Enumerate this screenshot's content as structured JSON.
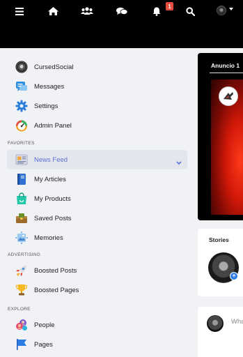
{
  "topbar": {
    "icons": [
      "menu-icon",
      "home-icon",
      "friends-icon",
      "chat-icon",
      "bell-icon",
      "search-icon"
    ],
    "notification_count": "1"
  },
  "sidebar": {
    "main_items": [
      {
        "label": "CursedSocial",
        "icon": "profile-avatar"
      },
      {
        "label": "Messages",
        "icon": "messages-icon"
      },
      {
        "label": "Settings",
        "icon": "gear-icon"
      },
      {
        "label": "Admin Panel",
        "icon": "gauge-icon"
      }
    ],
    "favorites_title": "FAVORITES",
    "favorites": [
      {
        "label": "News Feed",
        "icon": "newsfeed-icon",
        "active": true
      },
      {
        "label": "My Articles",
        "icon": "book-icon"
      },
      {
        "label": "My Products",
        "icon": "shopping-bag-icon"
      },
      {
        "label": "Saved Posts",
        "icon": "saved-icon"
      },
      {
        "label": "Memories",
        "icon": "memories-icon"
      }
    ],
    "advertising_title": "ADVERTISING",
    "advertising": [
      {
        "label": "Boosted Posts",
        "icon": "rocket-icon"
      },
      {
        "label": "Boosted Pages",
        "icon": "trophy-icon"
      }
    ],
    "explore_title": "EXPLORE",
    "explore": [
      {
        "label": "People",
        "icon": "people-icon"
      },
      {
        "label": "Pages",
        "icon": "flag-icon"
      }
    ]
  },
  "ad": {
    "title": "Anuncio 1"
  },
  "stories": {
    "title": "Stories"
  },
  "publisher": {
    "placeholder": "What"
  },
  "colors": {
    "topbar": "#000000",
    "active_text": "#5a6fd6",
    "badge": "#e74c3c",
    "story_plus": "#2d7be5"
  }
}
